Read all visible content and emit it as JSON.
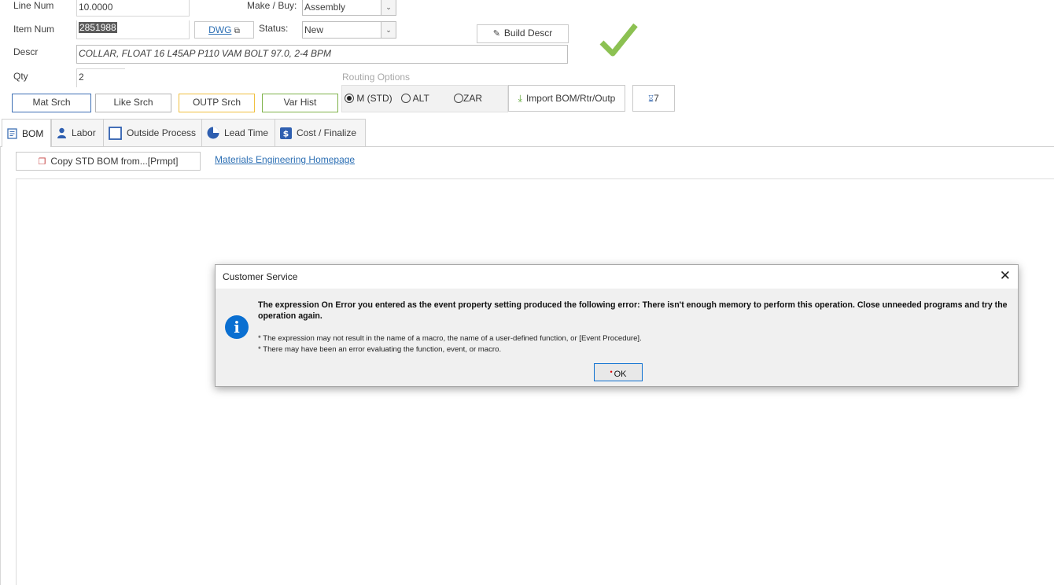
{
  "form": {
    "line_num_label": "Line Num",
    "line_num_value": "10.0000",
    "make_buy_label": "Make / Buy:",
    "make_buy_value": "Assembly",
    "item_num_label": "Item Num",
    "item_num_value": "2851988",
    "dwg_link": "DWG",
    "status_label": "Status:",
    "status_value": "New",
    "build_descr_button": "Build Descr",
    "descr_label": "Descr",
    "descr_value": "COLLAR, FLOAT 16 L45AP P110 VAM BOLT 97.0, 2-4 BPM",
    "qty_label": "Qty",
    "qty_value": "2",
    "routing_options_label": "Routing Options",
    "check_color": "#8cc152"
  },
  "search_buttons": {
    "mat_srch": "Mat Srch",
    "like_srch": "Like Srch",
    "outp_srch": "OUTP Srch",
    "var_hist": "Var Hist"
  },
  "routing": {
    "options": [
      "M (STD)",
      "ALT",
      "ZAR"
    ],
    "selected": "M (STD)",
    "import_button": "Import BOM/Rtr/Outp",
    "hourglass_count": "7"
  },
  "tabs": [
    {
      "label": "BOM",
      "icon": "list-doc-icon",
      "active": true
    },
    {
      "label": "Labor",
      "icon": "person-icon"
    },
    {
      "label": "Outside Process",
      "icon": "square-icon"
    },
    {
      "label": "Lead Time",
      "icon": "clock-icon"
    },
    {
      "label": "Cost / Finalize",
      "icon": "dollar-icon"
    }
  ],
  "bom": {
    "copy_button": "Copy STD BOM from...[Prmpt]",
    "homepage_link": "Materials Engineering Homepage"
  },
  "dialog": {
    "title": "Customer Service",
    "message": "The expression On Error you entered as the event property setting produced the following error: There isn't enough memory to perform this operation. Close unneeded programs and try the operation again.",
    "detail_1": "* The expression may not result in the name of a macro, the name of a user-defined function, or [Event Procedure].",
    "detail_2": "* There may have been an error evaluating the function, event, or macro.",
    "ok_button": "OK",
    "icon": "info-icon"
  },
  "colors": {
    "outp_border": "#f0c040",
    "var_hist_border": "#7fb24a",
    "mat_srch_border": "#3d6fb4",
    "link": "#2c6fb4",
    "accent_blue": "#0a6fd1"
  }
}
